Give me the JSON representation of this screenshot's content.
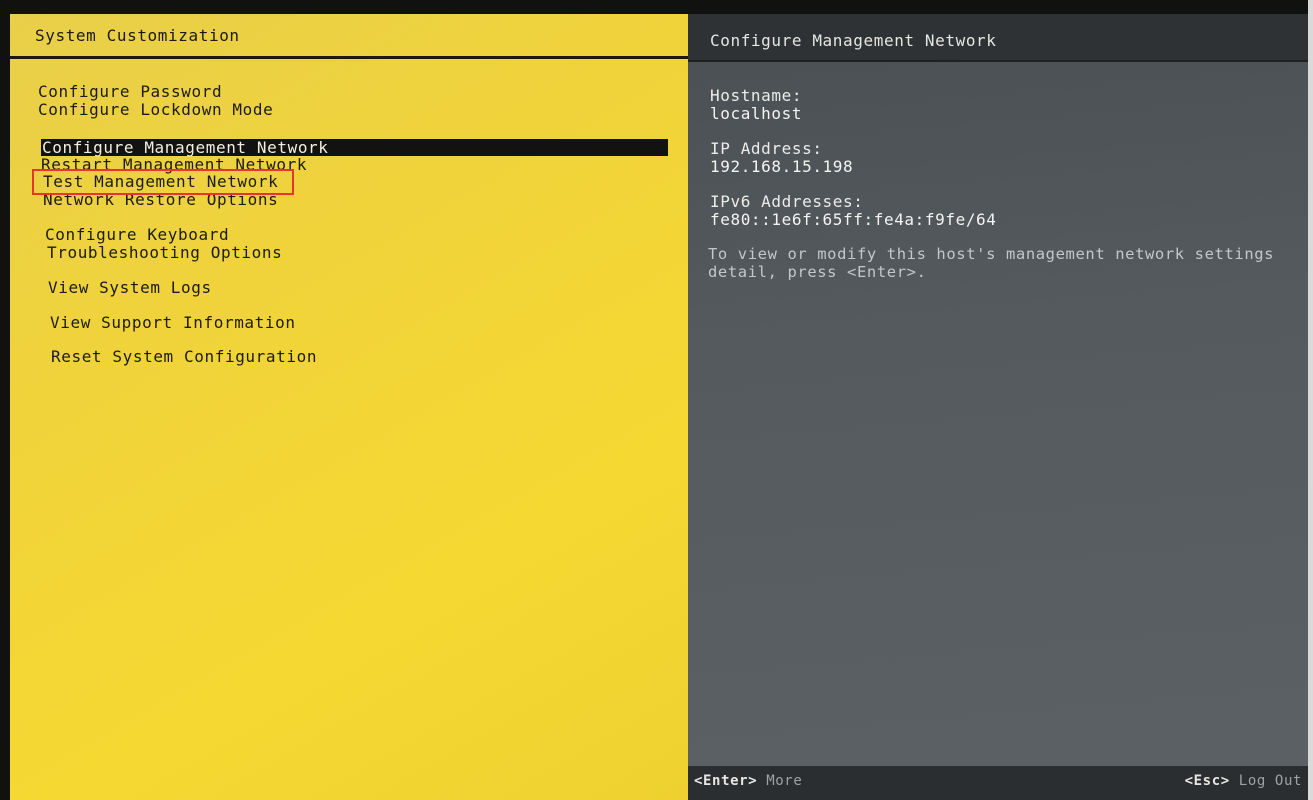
{
  "left_panel": {
    "title": "System Customization",
    "menu_items": [
      "Configure Password",
      "Configure Lockdown Mode",
      "Configure Management Network",
      "Restart Management Network",
      "Test Management Network",
      "Network Restore Options",
      "Configure Keyboard",
      "Troubleshooting Options",
      "View System Logs",
      "View Support Information",
      "Reset System Configuration"
    ],
    "selected_item": "Configure Management Network",
    "highlighted_item": "Test Management Network"
  },
  "right_panel": {
    "title": "Configure Management Network",
    "hostname_label": "Hostname:",
    "hostname_value": "localhost",
    "ip_label": "IP Address:",
    "ip_value": "192.168.15.198",
    "ipv6_label": "IPv6 Addresses:",
    "ipv6_value": "fe80::1e6f:65ff:fe4a:f9fe/64",
    "description_line1": "To view or modify this host's management network settings",
    "description_line2": "detail, press <Enter>."
  },
  "footer": {
    "enter_key": "<Enter>",
    "enter_action": "More",
    "esc_key": "<Esc>",
    "esc_action": "Log Out"
  },
  "colors": {
    "left_background": "#f3d636",
    "right_background": "#565b5f",
    "highlight_box": "#e8352c",
    "selected_bar": "#121210"
  }
}
